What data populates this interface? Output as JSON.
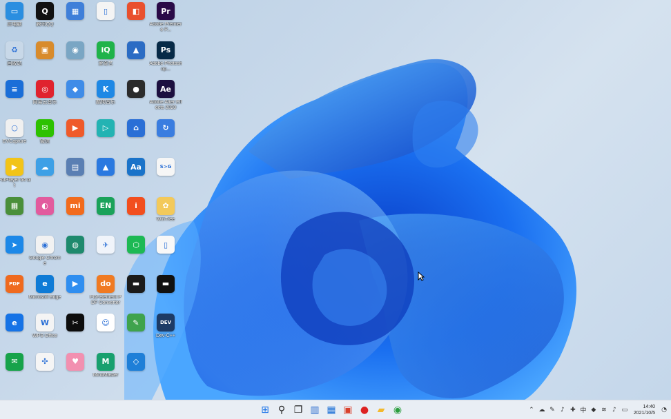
{
  "desktop": {
    "icons": [
      {
        "label": "此电脑",
        "bg": "#2a8ee0",
        "glyph": "▭",
        "col": 0,
        "row": 0
      },
      {
        "label": "腾讯QQ",
        "bg": "#111111",
        "glyph": "Q",
        "col": 1,
        "row": 0
      },
      {
        "label": "",
        "bg": "#3f7fd9",
        "glyph": "▦",
        "col": 2,
        "row": 0
      },
      {
        "label": "",
        "bg": "#f4f4f4",
        "glyph": "▯",
        "col": 3,
        "row": 0
      },
      {
        "label": "",
        "bg": "#e9502e",
        "glyph": "◧",
        "col": 4,
        "row": 0
      },
      {
        "label": "Adobe Premiere P...",
        "bg": "#2a0a47",
        "glyph": "Pr",
        "col": 5,
        "row": 0
      },
      {
        "label": "回收站",
        "bg": "#c8d8e8",
        "glyph": "♻",
        "col": 0,
        "row": 1
      },
      {
        "label": "",
        "bg": "#d88b2c",
        "glyph": "▣",
        "col": 1,
        "row": 1
      },
      {
        "label": "",
        "bg": "#7aa6c4",
        "glyph": "◉",
        "col": 2,
        "row": 1
      },
      {
        "label": "爱奇艺",
        "bg": "#1fb34a",
        "glyph": "iQ",
        "col": 3,
        "row": 1
      },
      {
        "label": "",
        "bg": "#2b6cc4",
        "glyph": "▲",
        "col": 4,
        "row": 1
      },
      {
        "label": "Adobe Photoshop...",
        "bg": "#072a47",
        "glyph": "Ps",
        "col": 5,
        "row": 1
      },
      {
        "label": "",
        "bg": "#1a6ed8",
        "glyph": "≡",
        "col": 0,
        "row": 2
      },
      {
        "label": "网易云音乐",
        "bg": "#e0232f",
        "glyph": "◎",
        "col": 1,
        "row": 2
      },
      {
        "label": "",
        "bg": "#3f8ce8",
        "glyph": "◆",
        "col": 2,
        "row": 2
      },
      {
        "label": "酷狗音乐",
        "bg": "#1e88e5",
        "glyph": "K",
        "col": 3,
        "row": 2
      },
      {
        "label": "",
        "bg": "#2b2b2b",
        "glyph": "●",
        "col": 4,
        "row": 2
      },
      {
        "label": "Adobe After Effects 2020",
        "bg": "#1c0f3f",
        "glyph": "Ae",
        "col": 5,
        "row": 2
      },
      {
        "label": "EVCapture",
        "bg": "#f0f0f0",
        "glyph": "○",
        "col": 0,
        "row": 3
      },
      {
        "label": "微信",
        "bg": "#2dc100",
        "glyph": "✉",
        "col": 1,
        "row": 3
      },
      {
        "label": "",
        "bg": "#ef5a2a",
        "glyph": "▶",
        "col": 2,
        "row": 3
      },
      {
        "label": "",
        "bg": "#23b3b3",
        "glyph": "▷",
        "col": 3,
        "row": 3
      },
      {
        "label": "",
        "bg": "#2a6fd6",
        "glyph": "⌂",
        "col": 4,
        "row": 3
      },
      {
        "label": "",
        "bg": "#3a7de0",
        "glyph": "↻",
        "col": 5,
        "row": 3
      },
      {
        "label": "PotPlayer 64 bit",
        "bg": "#f2c418",
        "glyph": "▶",
        "col": 0,
        "row": 4
      },
      {
        "label": "",
        "bg": "#3da0e6",
        "glyph": "☁",
        "col": 1,
        "row": 4
      },
      {
        "label": "",
        "bg": "#5a7fb3",
        "glyph": "▤",
        "col": 2,
        "row": 4
      },
      {
        "label": "",
        "bg": "#2a79e0",
        "glyph": "▲",
        "col": 3,
        "row": 4
      },
      {
        "label": "",
        "bg": "#1a73c9",
        "glyph": "Aa",
        "col": 4,
        "row": 4
      },
      {
        "label": "",
        "bg": "#f6f6f6",
        "glyph": "S>G",
        "col": 5,
        "row": 4
      },
      {
        "label": "",
        "bg": "#4a8f3a",
        "glyph": "▦",
        "col": 0,
        "row": 5
      },
      {
        "label": "",
        "bg": "#e25b9e",
        "glyph": "◐",
        "col": 1,
        "row": 5
      },
      {
        "label": "",
        "bg": "#f26b1d",
        "glyph": "mi",
        "col": 2,
        "row": 5
      },
      {
        "label": "",
        "bg": "#1aa25a",
        "glyph": "EN",
        "col": 3,
        "row": 5
      },
      {
        "label": "",
        "bg": "#f24e1e",
        "glyph": "i",
        "col": 4,
        "row": 5
      },
      {
        "label": "WinTree",
        "bg": "#f3c95a",
        "glyph": "✿",
        "col": 5,
        "row": 5
      },
      {
        "label": "",
        "bg": "#1c88e8",
        "glyph": "➤",
        "col": 0,
        "row": 6
      },
      {
        "label": "Google Chrome",
        "bg": "#f2f2f2",
        "glyph": "◉",
        "col": 1,
        "row": 6
      },
      {
        "label": "",
        "bg": "#1e8a6d",
        "glyph": "◍",
        "col": 2,
        "row": 6
      },
      {
        "label": "",
        "bg": "#f0f4fa",
        "glyph": "✈",
        "col": 3,
        "row": 6
      },
      {
        "label": "",
        "bg": "#1db954",
        "glyph": "⬡",
        "col": 4,
        "row": 6
      },
      {
        "label": "",
        "bg": "#f8f8f8",
        "glyph": "▯",
        "col": 5,
        "row": 6
      },
      {
        "label": "",
        "bg": "#ef6a1f",
        "glyph": "PDF",
        "col": 0,
        "row": 7
      },
      {
        "label": "Microsoft Edge",
        "bg": "#0f7bd6",
        "glyph": "e",
        "col": 1,
        "row": 7
      },
      {
        "label": "",
        "bg": "#2f8ef0",
        "glyph": "▶",
        "col": 2,
        "row": 7
      },
      {
        "label": "PDFelement PDF Converter",
        "bg": "#f07a22",
        "glyph": "do",
        "col": 3,
        "row": 7
      },
      {
        "label": "",
        "bg": "#1b1b1b",
        "glyph": "▬",
        "col": 4,
        "row": 7
      },
      {
        "label": "",
        "bg": "#111111",
        "glyph": "▬",
        "col": 5,
        "row": 7
      },
      {
        "label": "",
        "bg": "#1673e6",
        "glyph": "e",
        "col": 0,
        "row": 8
      },
      {
        "label": "WPS Office",
        "bg": "#f4f4f4",
        "glyph": "W",
        "col": 1,
        "row": 8
      },
      {
        "label": "",
        "bg": "#0d0d0d",
        "glyph": "✂",
        "col": 2,
        "row": 8
      },
      {
        "label": "",
        "bg": "#ffffff",
        "glyph": "☺",
        "col": 3,
        "row": 8
      },
      {
        "label": "",
        "bg": "#3fa34d",
        "glyph": "✎",
        "col": 4,
        "row": 8
      },
      {
        "label": "Dev-C++",
        "bg": "#1d3b66",
        "glyph": "DEV",
        "col": 5,
        "row": 8
      },
      {
        "label": "",
        "bg": "#17a34a",
        "glyph": "✉",
        "col": 0,
        "row": 9
      },
      {
        "label": "",
        "bg": "#f5f5f5",
        "glyph": "✣",
        "col": 1,
        "row": 9
      },
      {
        "label": "",
        "bg": "#f290b0",
        "glyph": "♥",
        "col": 2,
        "row": 9
      },
      {
        "label": "MindMaster",
        "bg": "#18a06e",
        "glyph": "M",
        "col": 3,
        "row": 9
      },
      {
        "label": "",
        "bg": "#1e7fd8",
        "glyph": "◇",
        "col": 4,
        "row": 9
      }
    ]
  },
  "taskbar": {
    "apps": [
      {
        "name": "start-button",
        "bg": "transparent",
        "glyph": "⊞",
        "color": "#1a73e8"
      },
      {
        "name": "search-button",
        "bg": "transparent",
        "glyph": "⚲",
        "color": "#222"
      },
      {
        "name": "task-view-button",
        "bg": "transparent",
        "glyph": "❐",
        "color": "#222"
      },
      {
        "name": "widgets-button",
        "bg": "transparent",
        "glyph": "▥",
        "color": "#2b6ccf"
      },
      {
        "name": "store-button",
        "bg": "transparent",
        "glyph": "▦",
        "color": "#1b6fd6"
      },
      {
        "name": "taskbar-app-red",
        "bg": "transparent",
        "glyph": "▣",
        "color": "#d9412c"
      },
      {
        "name": "taskbar-app-record",
        "bg": "transparent",
        "glyph": "●",
        "color": "#d22"
      },
      {
        "name": "file-explorer-button",
        "bg": "transparent",
        "glyph": "▰",
        "color": "#f3b92d"
      },
      {
        "name": "chrome-button",
        "bg": "transparent",
        "glyph": "◉",
        "color": "#2a9d3d"
      }
    ],
    "tray": [
      "⌃",
      "☁",
      "✎",
      "♪",
      "✚",
      "中",
      "◆",
      "≋",
      "♪",
      "▭"
    ],
    "time": "14:40",
    "date": "2021/10/5"
  }
}
